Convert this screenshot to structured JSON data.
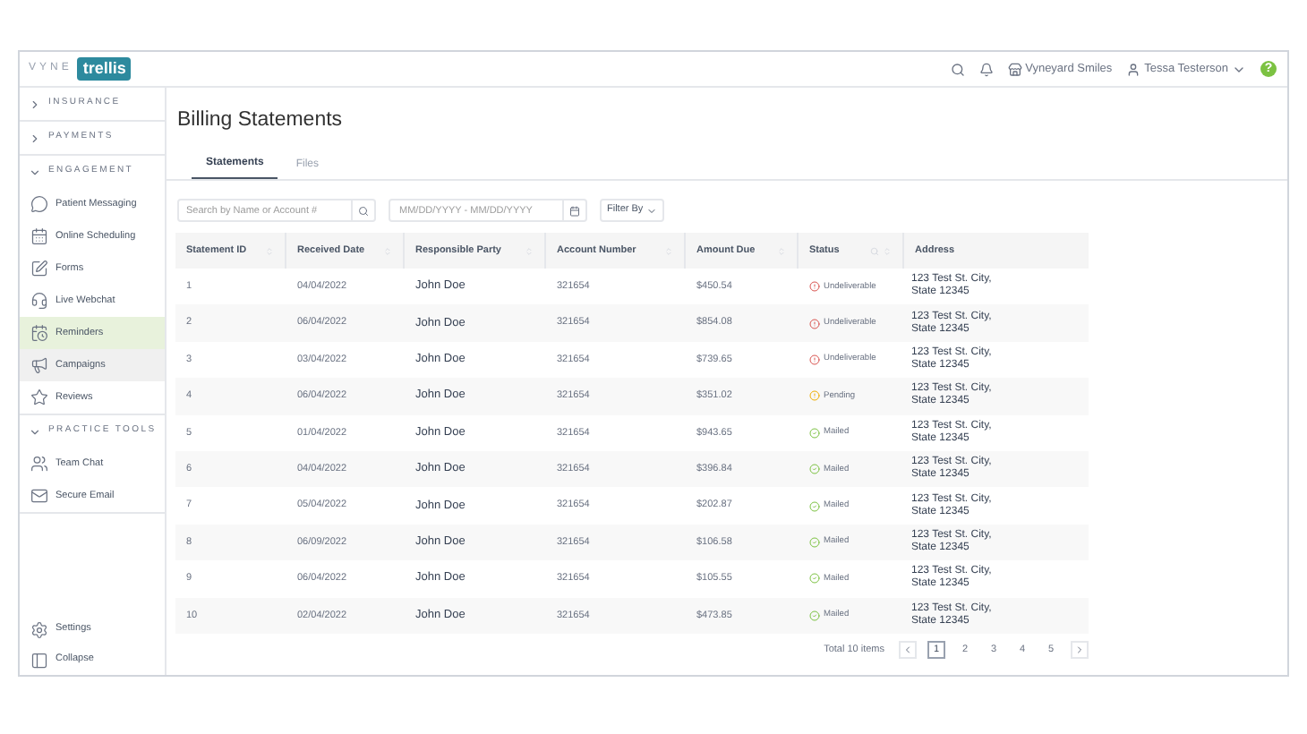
{
  "logo": {
    "prefix": "VYNE",
    "name": "trellis"
  },
  "topbar": {
    "practice": "Vyneyard Smiles",
    "user": "Tessa Testerson",
    "help": "?"
  },
  "sidebar": {
    "sections": [
      {
        "label": "INSURANCE",
        "expanded": false
      },
      {
        "label": "PAYMENTS",
        "expanded": false
      },
      {
        "label": "ENGAGEMENT",
        "expanded": true,
        "items": [
          {
            "label": "Patient Messaging",
            "selected": false,
            "hovered": false
          },
          {
            "label": "Online Scheduling",
            "selected": false,
            "hovered": false
          },
          {
            "label": "Forms",
            "selected": false,
            "hovered": false
          },
          {
            "label": "Live Webchat",
            "selected": false,
            "hovered": false
          },
          {
            "label": "Reminders",
            "selected": true,
            "hovered": false
          },
          {
            "label": "Campaigns",
            "selected": false,
            "hovered": true
          },
          {
            "label": "Reviews",
            "selected": false,
            "hovered": false
          }
        ]
      },
      {
        "label": "PRACTICE TOOLS",
        "expanded": true,
        "items": [
          {
            "label": "Team Chat",
            "selected": false,
            "hovered": false
          },
          {
            "label": "Secure Email",
            "selected": false,
            "hovered": false
          }
        ]
      }
    ],
    "footer": [
      {
        "label": "Settings"
      },
      {
        "label": "Collapse"
      }
    ]
  },
  "title": "Billing Statements",
  "tabs": [
    {
      "label": "Statements",
      "selected": true
    },
    {
      "label": "Files",
      "selected": false
    }
  ],
  "search": {
    "placeholder": "Search by Name or Account #"
  },
  "date_range": {
    "placeholder": "MM/DD/YYYY - MM/DD/YYYY"
  },
  "filter": {
    "label": "Filter By"
  },
  "table": {
    "columns": [
      {
        "label": "Statement ID"
      },
      {
        "label": "Received Date"
      },
      {
        "label": "Responsible Party"
      },
      {
        "label": "Account Number"
      },
      {
        "label": "Amount Due"
      },
      {
        "label": "Status"
      },
      {
        "label": "Address"
      }
    ],
    "rows": [
      {
        "id": "1",
        "date": "04/04/2022",
        "party": "John Doe",
        "account": "321654",
        "amount": "$450.54",
        "status": {
          "kind": "undeliverable",
          "label": "Undeliverable"
        },
        "address": [
          "123 Test St. City,",
          "State 12345"
        ]
      },
      {
        "id": "2",
        "date": "06/04/2022",
        "party": "John Doe",
        "account": "321654",
        "amount": "$854.08",
        "status": {
          "kind": "undeliverable",
          "label": "Undeliverable"
        },
        "address": [
          "123 Test St. City,",
          "State 12345"
        ]
      },
      {
        "id": "3",
        "date": "03/04/2022",
        "party": "John Doe",
        "account": "321654",
        "amount": "$739.65",
        "status": {
          "kind": "undeliverable",
          "label": "Undeliverable"
        },
        "address": [
          "123 Test St. City,",
          "State 12345"
        ]
      },
      {
        "id": "4",
        "date": "06/04/2022",
        "party": "John Doe",
        "account": "321654",
        "amount": "$351.02",
        "status": {
          "kind": "pending",
          "label": "Pending"
        },
        "address": [
          "123 Test St. City,",
          "State 12345"
        ]
      },
      {
        "id": "5",
        "date": "01/04/2022",
        "party": "John Doe",
        "account": "321654",
        "amount": "$943.65",
        "status": {
          "kind": "mailed",
          "label": "Mailed"
        },
        "address": [
          "123 Test St. City,",
          "State 12345"
        ]
      },
      {
        "id": "6",
        "date": "04/04/2022",
        "party": "John Doe",
        "account": "321654",
        "amount": "$396.84",
        "status": {
          "kind": "mailed",
          "label": "Mailed"
        },
        "address": [
          "123 Test St. City,",
          "State 12345"
        ]
      },
      {
        "id": "7",
        "date": "05/04/2022",
        "party": "John Doe",
        "account": "321654",
        "amount": "$202.87",
        "status": {
          "kind": "mailed",
          "label": "Mailed"
        },
        "address": [
          "123 Test St. City,",
          "State 12345"
        ]
      },
      {
        "id": "8",
        "date": "06/09/2022",
        "party": "John Doe",
        "account": "321654",
        "amount": "$106.58",
        "status": {
          "kind": "mailed",
          "label": "Mailed"
        },
        "address": [
          "123 Test St. City,",
          "State 12345"
        ]
      },
      {
        "id": "9",
        "date": "06/04/2022",
        "party": "John Doe",
        "account": "321654",
        "amount": "$105.55",
        "status": {
          "kind": "mailed",
          "label": "Mailed"
        },
        "address": [
          "123 Test St. City,",
          "State 12345"
        ]
      },
      {
        "id": "10",
        "date": "02/04/2022",
        "party": "John Doe",
        "account": "321654",
        "amount": "$473.85",
        "status": {
          "kind": "mailed",
          "label": "Mailed"
        },
        "address": [
          "123 Test St. City,",
          "State 12345"
        ]
      }
    ]
  },
  "pagination": {
    "total": "Total 10 items",
    "pages": [
      {
        "label": "1",
        "selected": true
      },
      {
        "label": "2",
        "selected": false
      },
      {
        "label": "3",
        "selected": false
      },
      {
        "label": "4",
        "selected": false
      },
      {
        "label": "5",
        "selected": false
      }
    ]
  }
}
